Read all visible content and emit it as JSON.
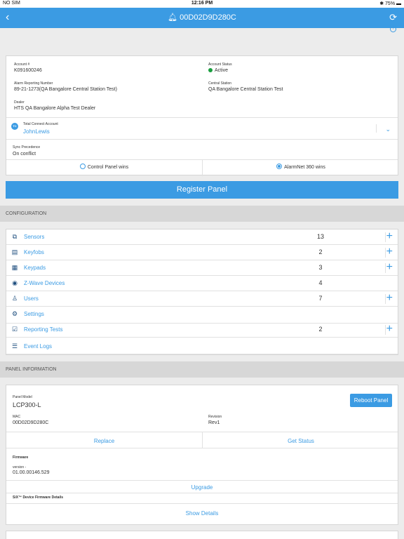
{
  "status_bar": {
    "carrier": "NO SIM",
    "time": "12:16 PM",
    "battery": "75%"
  },
  "nav": {
    "title": "00D02D9D280C"
  },
  "account": {
    "account_no_label": "Account #",
    "account_no": "K091600246",
    "account_status_label": "Account Status",
    "account_status": "Active",
    "alarm_no_label": "Alarm Reporting Number",
    "alarm_no": "89-21-1273(QA Bangalore Central Station Test)",
    "central_station_label": "Central Station",
    "central_station": "QA Bangalore Central Station Test",
    "dealer_label": "Dealer",
    "dealer": "HTS QA Bangalore Alpha Test Dealer",
    "tc_badge": "TC",
    "tc_label": "Total Connect Account",
    "tc_value": "JohnLewis",
    "sync_label": "Sync Precedence",
    "sync_value": "On conflict",
    "option_control_panel": "Control Panel wins",
    "option_alarmnet": "AlarmNet 360 wins",
    "selected_option": "AlarmNet 360 wins"
  },
  "register_button": "Register Panel",
  "configuration": {
    "header": "CONFIGURATION",
    "items": [
      {
        "name": "Sensors",
        "count": "13",
        "icon": "sensors-icon",
        "glyph": "⧉",
        "addable": true
      },
      {
        "name": "Keyfobs",
        "count": "2",
        "icon": "keyfob-icon",
        "glyph": "▤",
        "addable": true
      },
      {
        "name": "Keypads",
        "count": "3",
        "icon": "keypad-icon",
        "glyph": "▦",
        "addable": true
      },
      {
        "name": "Z-Wave Devices",
        "count": "4",
        "icon": "zwave-icon",
        "glyph": "◉",
        "addable": false
      },
      {
        "name": "Users",
        "count": "7",
        "icon": "users-icon",
        "glyph": "♙",
        "addable": true
      },
      {
        "name": "Settings",
        "count": "",
        "icon": "gear-icon",
        "glyph": "⚙",
        "addable": false
      },
      {
        "name": "Reporting Tests",
        "count": "2",
        "icon": "reporting-tests-icon",
        "glyph": "☑",
        "addable": true
      },
      {
        "name": "Event Logs",
        "count": "",
        "icon": "event-logs-icon",
        "glyph": "☰",
        "addable": false
      }
    ]
  },
  "panel_info": {
    "header": "PANEL INFORMATION",
    "model_label": "Panel Model",
    "model": "LCP300-L",
    "reboot_button": "Reboot Panel",
    "mac_label": "MAC",
    "mac": "00D02D9D280C",
    "revision_label": "Revision",
    "revision": "Rev1",
    "replace_link": "Replace",
    "get_status_link": "Get Status",
    "firmware_label": "Firmware",
    "version_label": "version -",
    "version": "01.00.00146.529",
    "upgrade_link": "Upgrade",
    "six_label": "SiX™ Device Firmware Details",
    "show_details_link": "Show Details"
  },
  "colors": {
    "accent": "#3b9be3",
    "status_active": "#1a9e3f"
  }
}
